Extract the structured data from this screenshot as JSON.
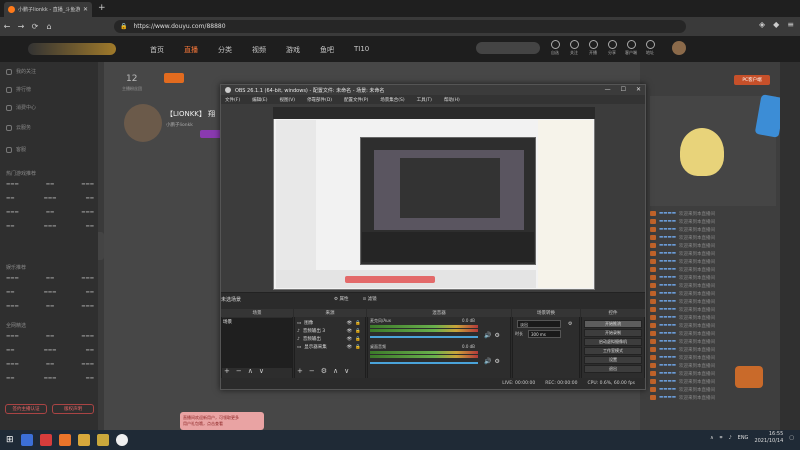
{
  "browser": {
    "tab_title": "小鹏子lionkk - 直播_斗鱼游戏",
    "url": "https://www.douyu.com/88880",
    "new_tab": "+",
    "back": "←",
    "forward": "→",
    "reload": "⟳",
    "home": "⌂"
  },
  "site": {
    "nav": [
      "首页",
      "直播",
      "分类",
      "视频",
      "游戏",
      "鱼吧",
      "TI10"
    ],
    "header_icons": [
      "自选",
      "关注",
      "开播",
      "分享",
      "客户端",
      "地址"
    ]
  },
  "sidebar": {
    "items": [
      "我的关注",
      "排行榜",
      "消费中心",
      "云服务",
      "客服"
    ],
    "section1_title": "热门游戏推荐",
    "section2_title": "娱乐推荐",
    "section3_title": "全网精选",
    "btn1": "签约主播认证",
    "btn2": "版权声明"
  },
  "streamer": {
    "count": "12",
    "count_label": "主播粉丝团",
    "name": "【LIONKK】 翔",
    "tag": "小鹏子lionkk",
    "badge": "斗鱼"
  },
  "obs": {
    "title": "OBS 26.1.1 (64-bit, windows) - 配置文件: 未命名 - 场景: 未命名",
    "menu": [
      "文件(F)",
      "编辑(E)",
      "视图(V)",
      "停靠部件(D)",
      "配置文件(P)",
      "场景集合(S)",
      "工具(T)",
      "帮助(H)"
    ],
    "window_controls": [
      "—",
      "☐",
      "✕"
    ],
    "scene_label": "未选场景",
    "ctl_props": "⚙ 属性",
    "ctl_filter": "⊙ 滤镜",
    "docks": {
      "scenes": "场景",
      "sources": "来源",
      "mixer": "混音器",
      "transitions": "场景转换",
      "controls": "控件"
    },
    "scene_items": [
      "场景"
    ],
    "sources": [
      "图像",
      "音频输出 3",
      "音频输出",
      "显示器采集"
    ],
    "mixer": [
      {
        "name": "麦克风/Aux",
        "db": "0.0 dB"
      },
      {
        "name": "桌面音频",
        "db": "0.0 dB"
      }
    ],
    "transition_type": "淡出",
    "transition_label": "时长",
    "transition_duration": "300 ms",
    "controls": [
      "开始推流",
      "开始录制",
      "启动虚拟摄像机",
      "工作室模式",
      "设置",
      "退出"
    ],
    "status": {
      "live": "LIVE: 00:00:00",
      "rec": "REC: 00:00:00",
      "cpu": "CPU: 0.6%, 60.00 fps"
    }
  },
  "right_panel": {
    "pc_button": "PC客户端",
    "chat_text": "欢迎来到本直播间"
  },
  "toast": {
    "line1": "直播间欢迎新用户，可领取更多",
    "line2": "用户礼包哦，点击查看"
  },
  "taskbar": {
    "lang": "ENG",
    "time": "16:55",
    "date": "2021/10/14"
  }
}
